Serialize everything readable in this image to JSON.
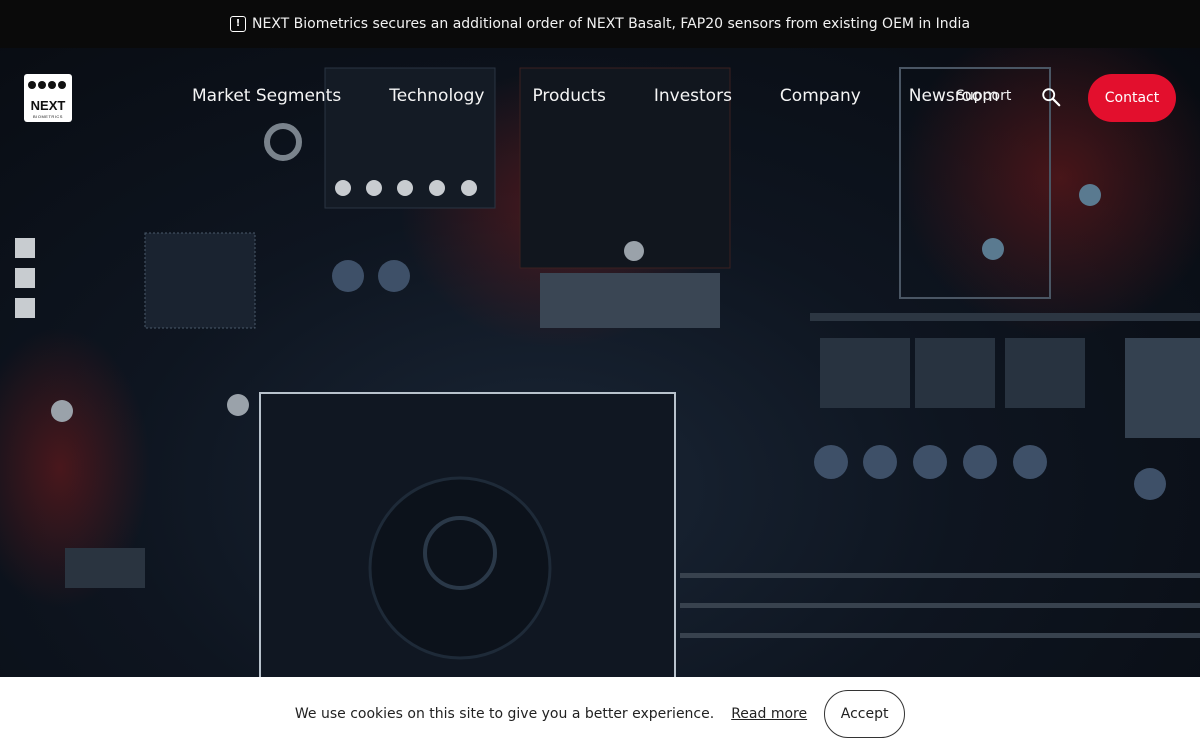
{
  "announcement": {
    "text": "NEXT Biometrics secures an additional order of NEXT Basalt, FAP20 sensors from existing OEM in India",
    "icon": "exclamation-icon"
  },
  "header": {
    "logo": {
      "word": "NEXT",
      "sub": "BIOMETRICS"
    },
    "menu": [
      "Market Segments",
      "Technology",
      "Products",
      "Investors",
      "Company",
      "Newsroom"
    ],
    "support_label": "Support",
    "search_icon": "search-icon",
    "contact_label": "Contact"
  },
  "colors": {
    "accent": "#e30f2d",
    "topbar": "#0a0a0a"
  },
  "cookie": {
    "message": "We use cookies on this site to give you a better experience.",
    "read_more": "Read more",
    "accept": "Accept"
  }
}
